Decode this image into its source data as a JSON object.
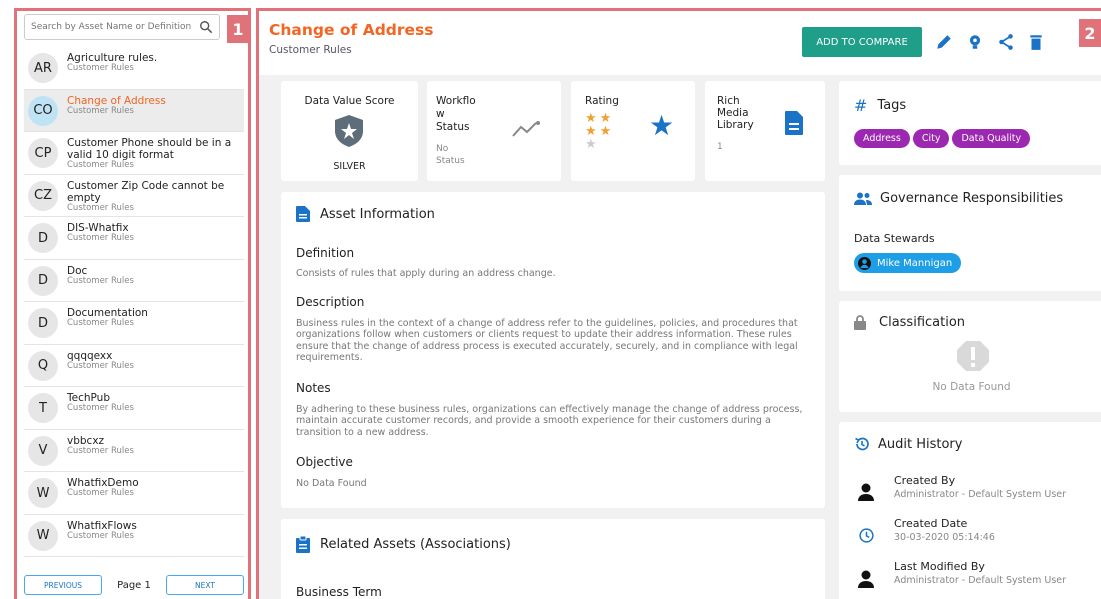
{
  "panel1": {
    "badge": "1",
    "search_placeholder": "Search by Asset Name or Definition",
    "items": [
      {
        "initials": "AR",
        "title": "Agriculture rules.",
        "sub": "Customer Rules"
      },
      {
        "initials": "CO",
        "title": "Change of Address",
        "sub": "Customer Rules",
        "selected": true
      },
      {
        "initials": "CP",
        "title": "Customer Phone should be in a valid 10 digit format",
        "sub": "Customer Rules"
      },
      {
        "initials": "CZ",
        "title": "Customer Zip Code cannot be empty",
        "sub": "Customer Rules"
      },
      {
        "initials": "D",
        "title": "DIS-Whatfix",
        "sub": "Customer Rules"
      },
      {
        "initials": "D",
        "title": "Doc",
        "sub": "Customer Rules"
      },
      {
        "initials": "D",
        "title": "Documentation",
        "sub": "Customer Rules"
      },
      {
        "initials": "Q",
        "title": "qqqqexx",
        "sub": "Customer Rules"
      },
      {
        "initials": "T",
        "title": "TechPub",
        "sub": "Customer Rules"
      },
      {
        "initials": "V",
        "title": "vbbcxz",
        "sub": "Customer Rules"
      },
      {
        "initials": "W",
        "title": "WhatfixDemo",
        "sub": "Customer Rules"
      },
      {
        "initials": "W",
        "title": "WhatfixFlows",
        "sub": "Customer Rules"
      }
    ],
    "pager": {
      "prev": "PREVIOUS",
      "page": "Page 1",
      "next": "NEXT"
    }
  },
  "panel2": {
    "badge": "2",
    "title": "Change of Address",
    "subtitle": "Customer Rules",
    "compare_label": "ADD TO COMPARE",
    "dv": {
      "label": "Data Value Score",
      "value": "SILVER"
    },
    "workflow": {
      "label_l1": "Workflo",
      "label_l2": "w",
      "label_l3": "Status",
      "status_l1": "No",
      "status_l2": "Status"
    },
    "rating": {
      "label": "Rating",
      "stars": 4
    },
    "rich": {
      "label_l1": "Rich",
      "label_l2": "Media",
      "label_l3": "Library",
      "count": "1"
    },
    "asset_info": {
      "title": "Asset Information",
      "definition_label": "Definition",
      "definition": "Consists of rules that apply during an address change.",
      "description_label": "Description",
      "description": "Business rules in the context of a change of address refer to the guidelines, policies, and procedures that organizations follow when customers or clients request to update their address information. These rules ensure that the change of address process is executed accurately, securely, and in compliance with legal requirements.",
      "notes_label": "Notes",
      "notes": "By adhering to these business rules, organizations can effectively manage the change of address process, maintain accurate customer records, and provide a smooth experience for their customers during a transition to a new address.",
      "objective_label": "Objective",
      "objective": "No Data Found"
    },
    "related": {
      "title": "Related Assets (Associations)",
      "business_term": "Business Term"
    },
    "tags": {
      "title": "Tags",
      "items": [
        "Address",
        "City",
        "Data Quality"
      ],
      "color": "#9c27b0"
    },
    "governance": {
      "title": "Governance Responsibilities",
      "stewards_label": "Data Stewards",
      "steward": "Mike Mannigan"
    },
    "classification": {
      "title": "Classification",
      "empty": "No Data Found"
    },
    "audit": {
      "title": "Audit History",
      "created_by_label": "Created By",
      "created_by": "Administrator - Default System User",
      "created_date_label": "Created Date",
      "created_date": "30-03-2020 05:14:46",
      "modified_by_label": "Last Modified By",
      "modified_by": "Administrator - Default System User"
    }
  }
}
